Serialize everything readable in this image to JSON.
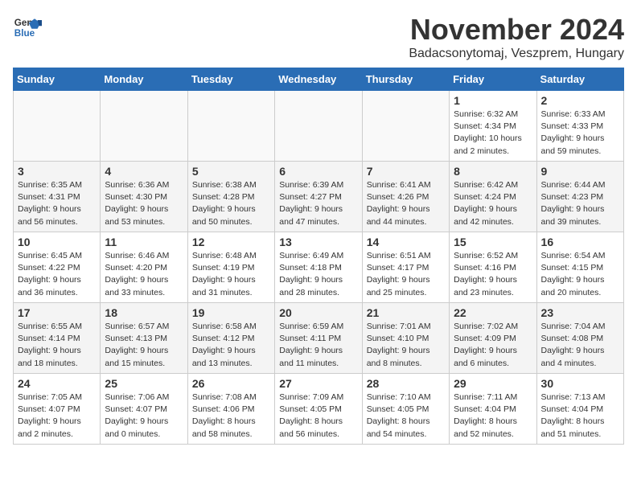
{
  "logo": {
    "general": "General",
    "blue": "Blue"
  },
  "header": {
    "month": "November 2024",
    "location": "Badacsonytomaj, Veszprem, Hungary"
  },
  "weekdays": [
    "Sunday",
    "Monday",
    "Tuesday",
    "Wednesday",
    "Thursday",
    "Friday",
    "Saturday"
  ],
  "weeks": [
    {
      "days": [
        {
          "date": "",
          "info": ""
        },
        {
          "date": "",
          "info": ""
        },
        {
          "date": "",
          "info": ""
        },
        {
          "date": "",
          "info": ""
        },
        {
          "date": "",
          "info": ""
        },
        {
          "date": "1",
          "info": "Sunrise: 6:32 AM\nSunset: 4:34 PM\nDaylight: 10 hours\nand 2 minutes."
        },
        {
          "date": "2",
          "info": "Sunrise: 6:33 AM\nSunset: 4:33 PM\nDaylight: 9 hours\nand 59 minutes."
        }
      ]
    },
    {
      "days": [
        {
          "date": "3",
          "info": "Sunrise: 6:35 AM\nSunset: 4:31 PM\nDaylight: 9 hours\nand 56 minutes."
        },
        {
          "date": "4",
          "info": "Sunrise: 6:36 AM\nSunset: 4:30 PM\nDaylight: 9 hours\nand 53 minutes."
        },
        {
          "date": "5",
          "info": "Sunrise: 6:38 AM\nSunset: 4:28 PM\nDaylight: 9 hours\nand 50 minutes."
        },
        {
          "date": "6",
          "info": "Sunrise: 6:39 AM\nSunset: 4:27 PM\nDaylight: 9 hours\nand 47 minutes."
        },
        {
          "date": "7",
          "info": "Sunrise: 6:41 AM\nSunset: 4:26 PM\nDaylight: 9 hours\nand 44 minutes."
        },
        {
          "date": "8",
          "info": "Sunrise: 6:42 AM\nSunset: 4:24 PM\nDaylight: 9 hours\nand 42 minutes."
        },
        {
          "date": "9",
          "info": "Sunrise: 6:44 AM\nSunset: 4:23 PM\nDaylight: 9 hours\nand 39 minutes."
        }
      ]
    },
    {
      "days": [
        {
          "date": "10",
          "info": "Sunrise: 6:45 AM\nSunset: 4:22 PM\nDaylight: 9 hours\nand 36 minutes."
        },
        {
          "date": "11",
          "info": "Sunrise: 6:46 AM\nSunset: 4:20 PM\nDaylight: 9 hours\nand 33 minutes."
        },
        {
          "date": "12",
          "info": "Sunrise: 6:48 AM\nSunset: 4:19 PM\nDaylight: 9 hours\nand 31 minutes."
        },
        {
          "date": "13",
          "info": "Sunrise: 6:49 AM\nSunset: 4:18 PM\nDaylight: 9 hours\nand 28 minutes."
        },
        {
          "date": "14",
          "info": "Sunrise: 6:51 AM\nSunset: 4:17 PM\nDaylight: 9 hours\nand 25 minutes."
        },
        {
          "date": "15",
          "info": "Sunrise: 6:52 AM\nSunset: 4:16 PM\nDaylight: 9 hours\nand 23 minutes."
        },
        {
          "date": "16",
          "info": "Sunrise: 6:54 AM\nSunset: 4:15 PM\nDaylight: 9 hours\nand 20 minutes."
        }
      ]
    },
    {
      "days": [
        {
          "date": "17",
          "info": "Sunrise: 6:55 AM\nSunset: 4:14 PM\nDaylight: 9 hours\nand 18 minutes."
        },
        {
          "date": "18",
          "info": "Sunrise: 6:57 AM\nSunset: 4:13 PM\nDaylight: 9 hours\nand 15 minutes."
        },
        {
          "date": "19",
          "info": "Sunrise: 6:58 AM\nSunset: 4:12 PM\nDaylight: 9 hours\nand 13 minutes."
        },
        {
          "date": "20",
          "info": "Sunrise: 6:59 AM\nSunset: 4:11 PM\nDaylight: 9 hours\nand 11 minutes."
        },
        {
          "date": "21",
          "info": "Sunrise: 7:01 AM\nSunset: 4:10 PM\nDaylight: 9 hours\nand 8 minutes."
        },
        {
          "date": "22",
          "info": "Sunrise: 7:02 AM\nSunset: 4:09 PM\nDaylight: 9 hours\nand 6 minutes."
        },
        {
          "date": "23",
          "info": "Sunrise: 7:04 AM\nSunset: 4:08 PM\nDaylight: 9 hours\nand 4 minutes."
        }
      ]
    },
    {
      "days": [
        {
          "date": "24",
          "info": "Sunrise: 7:05 AM\nSunset: 4:07 PM\nDaylight: 9 hours\nand 2 minutes."
        },
        {
          "date": "25",
          "info": "Sunrise: 7:06 AM\nSunset: 4:07 PM\nDaylight: 9 hours\nand 0 minutes."
        },
        {
          "date": "26",
          "info": "Sunrise: 7:08 AM\nSunset: 4:06 PM\nDaylight: 8 hours\nand 58 minutes."
        },
        {
          "date": "27",
          "info": "Sunrise: 7:09 AM\nSunset: 4:05 PM\nDaylight: 8 hours\nand 56 minutes."
        },
        {
          "date": "28",
          "info": "Sunrise: 7:10 AM\nSunset: 4:05 PM\nDaylight: 8 hours\nand 54 minutes."
        },
        {
          "date": "29",
          "info": "Sunrise: 7:11 AM\nSunset: 4:04 PM\nDaylight: 8 hours\nand 52 minutes."
        },
        {
          "date": "30",
          "info": "Sunrise: 7:13 AM\nSunset: 4:04 PM\nDaylight: 8 hours\nand 51 minutes."
        }
      ]
    }
  ]
}
